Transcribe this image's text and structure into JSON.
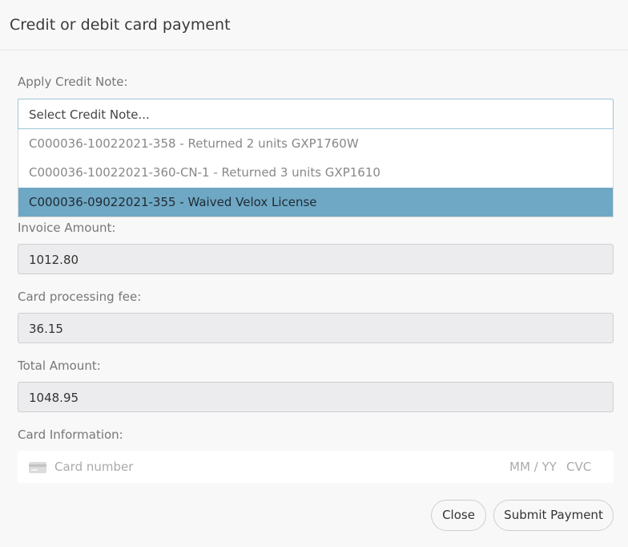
{
  "modal": {
    "title": "Credit or debit card payment"
  },
  "credit_note": {
    "label": "Apply Credit Note:",
    "select_placeholder": "Select Credit Note...",
    "options": [
      "C000036-10022021-358 - Returned 2 units GXP1760W",
      "C000036-10022021-360-CN-1 - Returned 3 units GXP1610",
      "C000036-09022021-355 - Waived Velox License"
    ],
    "highlighted_index": 2
  },
  "invoice_amount": {
    "label": "Invoice Amount:",
    "value": "1012.80"
  },
  "card_fee": {
    "label": "Card processing fee:",
    "value": "36.15"
  },
  "total_amount": {
    "label": "Total Amount:",
    "value": "1048.95"
  },
  "card_info": {
    "label": "Card Information:",
    "number_placeholder": "Card number",
    "expiry_placeholder": "MM / YY",
    "cvc_placeholder": "CVC",
    "icon": "credit-card-icon"
  },
  "buttons": {
    "close": "Close",
    "submit": "Submit Payment"
  },
  "colors": {
    "highlight": "#6fa8c4",
    "background": "#f8f8f8"
  }
}
